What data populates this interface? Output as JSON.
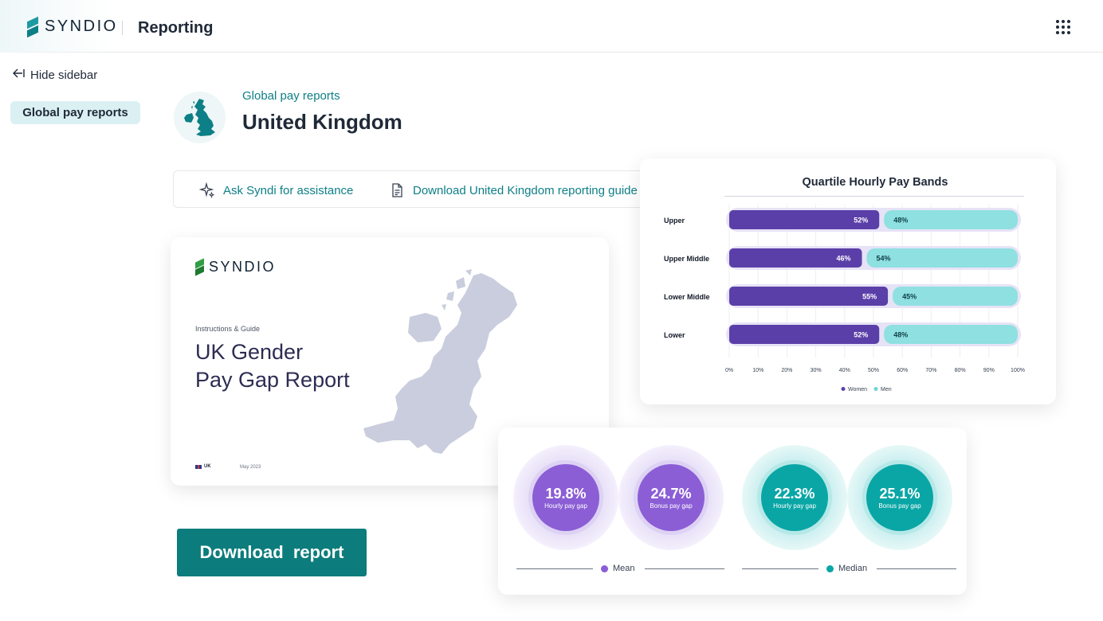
{
  "header": {
    "brand": "SYNDIO",
    "app_title": "Reporting",
    "apps_icon": "grid-icon"
  },
  "sidebar": {
    "hide_label": "Hide sidebar",
    "items": [
      {
        "label": "Global pay reports",
        "active": true
      }
    ]
  },
  "page": {
    "breadcrumb": "Global pay reports",
    "title": "United Kingdom",
    "flag_icon": "uk-map-icon"
  },
  "actions": [
    {
      "label": "Ask Syndi for assistance",
      "icon": "sparkle-icon"
    },
    {
      "label": "Download United Kingdom reporting guide",
      "icon": "document-icon"
    }
  ],
  "report_preview": {
    "brand": "SYNDIO",
    "subtitle": "Instructions & Guide",
    "title_line1": "UK Gender",
    "title_line2": "Pay Gap Report",
    "country": "UK",
    "date": "May 2023"
  },
  "download_button": "Download  report",
  "colors": {
    "teal": "#0d7c7c",
    "women": "#5b3fa8",
    "men": "#8fe0e0"
  },
  "chart_data": [
    {
      "type": "bar",
      "title": "Quartile Hourly Pay Bands",
      "stacked": true,
      "orientation": "horizontal",
      "categories": [
        "Upper",
        "Upper Middle",
        "Lower Middle",
        "Lower"
      ],
      "series": [
        {
          "name": "Women",
          "values": [
            52,
            46,
            55,
            52
          ],
          "color": "#5b3fa8"
        },
        {
          "name": "Men",
          "values": [
            48,
            54,
            45,
            48
          ],
          "color": "#8fe0e0"
        }
      ],
      "xlim": [
        0,
        100
      ],
      "xticks": [
        "0%",
        "10%",
        "20%",
        "30%",
        "40%",
        "50%",
        "60%",
        "70%",
        "80%",
        "90%",
        "100%"
      ],
      "legend": "bottom",
      "grid": true
    },
    {
      "type": "bubble",
      "groups": [
        {
          "name": "Mean",
          "color": "#8b5ed6",
          "items": [
            {
              "value": "19.8%",
              "label": "Hourly pay gap"
            },
            {
              "value": "24.7%",
              "label": "Bonus pay gap"
            }
          ]
        },
        {
          "name": "Median",
          "color": "#0aa6a6",
          "items": [
            {
              "value": "22.3%",
              "label": "Hourly pay gap"
            },
            {
              "value": "25.1%",
              "label": "Bonus pay gap"
            }
          ]
        }
      ]
    }
  ]
}
